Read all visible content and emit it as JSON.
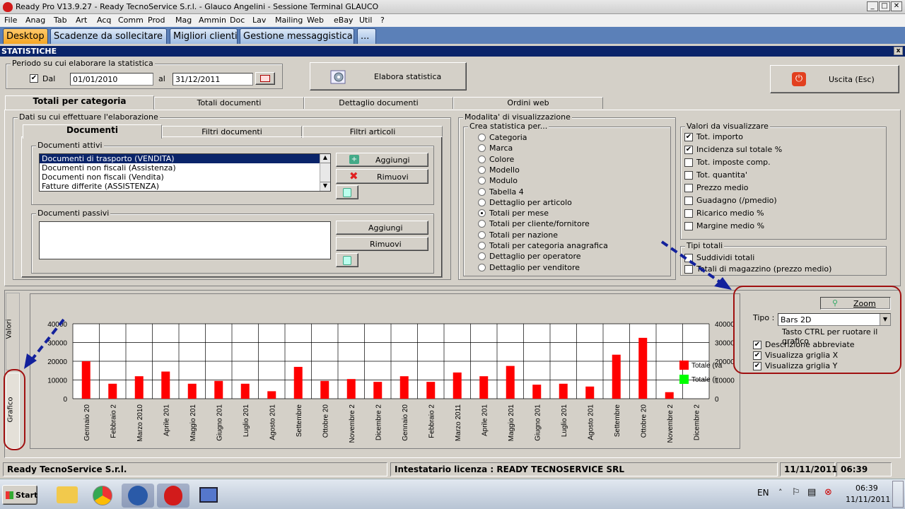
{
  "window": {
    "title": "Ready Pro V13.9.27 - Ready TecnoService S.r.l. - Glauco Angelini - Sessione Terminal GLAUCO",
    "min": "_",
    "max": "□",
    "close": "✕"
  },
  "menu": [
    "File",
    "Anag",
    "Tab",
    "Art",
    "Acq",
    "Comm",
    "Prod",
    "Mag",
    "Ammin",
    "Doc",
    "Lav",
    "Mailing",
    "Web",
    "eBay",
    "Util",
    "?"
  ],
  "desktop_tabs": [
    "Desktop",
    "Scadenze da sollecitare",
    "Migliori clienti",
    "Gestione messaggistica",
    "..."
  ],
  "panel": {
    "title": "STATISTICHE",
    "close": "x"
  },
  "period": {
    "label": "Periodo su cui elaborare la statistica",
    "dal_label": "Dal",
    "dal_checked": true,
    "from": "01/01/2010",
    "al_label": "al",
    "to": "31/12/2011"
  },
  "elabora_label": "Elabora statistica",
  "uscita_label": "Uscita (Esc)",
  "main_tabs": [
    "Totali per categoria",
    "Totali documenti",
    "Dettaglio documenti",
    "Ordini web"
  ],
  "dati": {
    "label": "Dati su cui effettuare l'elaborazione",
    "tabs": [
      "Documenti",
      "Filtri documenti",
      "Filtri articoli"
    ],
    "attivi_label": "Documenti attivi",
    "attivi": [
      "Documenti di trasporto (VENDITA)",
      "Documenti non fiscali (Assistenza)",
      "Documenti non fiscali (Vendita)",
      "Fatture differite (ASSISTENZA)"
    ],
    "passivi_label": "Documenti passivi",
    "aggiungi": "Aggiungi",
    "rimuovi": "Rimuovi"
  },
  "modalita": {
    "label": "Modalita' di visualizzazione",
    "crea_label": "Crea statistica per...",
    "options": [
      "Categoria",
      "Marca",
      "Colore",
      "Modello",
      "Modulo",
      "Tabella 4",
      "Dettaglio per articolo",
      "Totali per mese",
      "Totali per cliente/fornitore",
      "Totali per nazione",
      "Totali per categoria anagrafica",
      "Dettaglio per operatore",
      "Dettaglio per venditore"
    ],
    "selected": 7
  },
  "valori": {
    "label": "Valori da visualizzare",
    "items": [
      {
        "t": "Tot. importo",
        "c": true
      },
      {
        "t": "Incidenza sul totale %",
        "c": true
      },
      {
        "t": "Tot. imposte comp.",
        "c": false
      },
      {
        "t": "Tot. quantita'",
        "c": false
      },
      {
        "t": "Prezzo medio",
        "c": false
      },
      {
        "t": "Guadagno (/pmedio)",
        "c": false
      },
      {
        "t": "Ricarico medio %",
        "c": false
      },
      {
        "t": "Margine medio %",
        "c": false
      }
    ]
  },
  "tipi": {
    "label": "Tipi totali",
    "items": [
      {
        "t": "Suddividi totali",
        "c": false
      },
      {
        "t": "Totali di magazzino (prezzo medio)",
        "c": false
      }
    ]
  },
  "side_tabs": {
    "valori": "Valori",
    "grafico": "Grafico"
  },
  "chart_panel": {
    "zoom": "Zoom",
    "tipo_label": "Tipo :",
    "tipo_value": "Bars 2D",
    "hint": "Tasto CTRL per ruotare il grafico",
    "options": [
      {
        "t": "Descrizione abbreviate",
        "c": true
      },
      {
        "t": "Visualizza griglia X",
        "c": true
      },
      {
        "t": "Visualizza griglia Y",
        "c": true
      }
    ]
  },
  "chart_data": {
    "type": "bar",
    "categories": [
      "Gennaio 20",
      "Febbraio 2",
      "Marzo 2010",
      "Aprile 201",
      "Maggio 201",
      "Giugno 201",
      "Luglio 201",
      "Agosto 201",
      "Settembre",
      "Ottobre 20",
      "Novembre 2",
      "Dicembre 2",
      "Gennaio 20",
      "Febbraio 2",
      "Marzo 2011",
      "Aprile 201",
      "Maggio 201",
      "Giugno 201",
      "Luglio 201",
      "Agosto 201",
      "Settembre",
      "Ottobre 20",
      "Novembre 2",
      "Dicembre 2"
    ],
    "series": [
      {
        "name": "Totale (va",
        "values": [
          20000,
          8000,
          12000,
          14500,
          8000,
          9500,
          8000,
          4000,
          17000,
          9500,
          10500,
          9000,
          12000,
          9000,
          14000,
          12000,
          17500,
          7500,
          8000,
          6500,
          23500,
          32500,
          3500,
          0
        ]
      },
      {
        "name": "Totale (ir",
        "values": []
      }
    ],
    "yticks": [
      "40000",
      "30000",
      "20000",
      "10000",
      "0"
    ],
    "ylim": [
      0,
      40000
    ],
    "grid": true,
    "colors": [
      "#ff0000",
      "#00ff00"
    ]
  },
  "status": {
    "company": "Ready TecnoService S.r.l.",
    "license": "Intestatario licenza : READY TECNOSERVICE SRL",
    "date": "11/11/2011",
    "time": "06:39"
  },
  "taskbar": {
    "start": "Start",
    "lang": "EN",
    "clock_time": "06:39",
    "clock_date": "11/11/2011"
  }
}
